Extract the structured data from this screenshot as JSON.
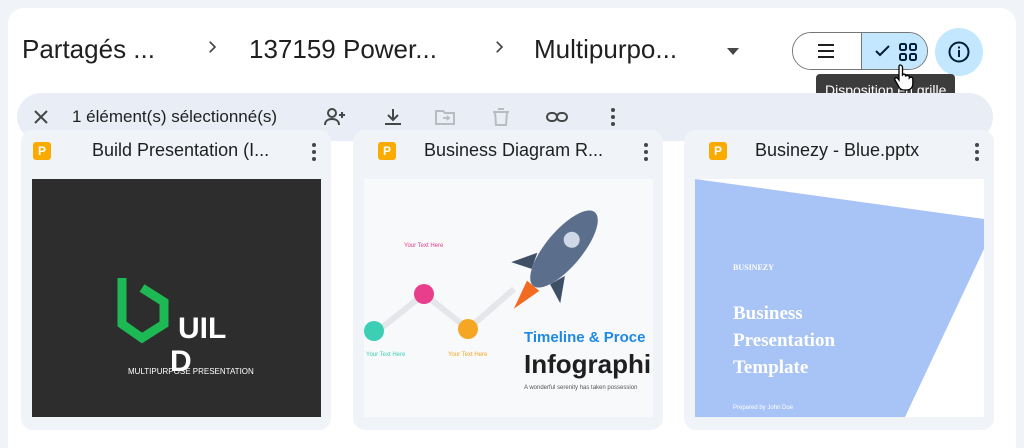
{
  "breadcrumb": {
    "items": [
      "Partagés ...",
      "137159 Power...",
      "Multipurpo..."
    ]
  },
  "view_toggle": {
    "tooltip": "Disposition en grille"
  },
  "selection_bar": {
    "count_label": "1 élément(s) sélectionné(s)"
  },
  "files": [
    {
      "name": "Build Presentation (I...",
      "thumb": {
        "logo_text_1": "UIL",
        "logo_text_2": "D",
        "subtitle": "MULTIPURPOSE PRESENTATION"
      }
    },
    {
      "name": "Business Diagram R...",
      "thumb": {
        "heading": "Timeline & Proce",
        "big": "Infographi",
        "label1": "Your Text Here",
        "label2": "Your Text Here",
        "label3": "Your Text Here",
        "snippet": "A wonderful serenity has taken possession"
      }
    },
    {
      "name": "Businezy - Blue.pptx",
      "thumb": {
        "brand": "BUSINEZY",
        "title_1": "Business",
        "title_2": "Presentation",
        "title_3": "Template",
        "footer": "Prepared by John Doe"
      }
    }
  ],
  "colors": {
    "accent": "#c2e7ff",
    "slides_yellow": "#f9ab00",
    "build_green": "#1db954",
    "blue_slide": "#a8c3f5"
  }
}
